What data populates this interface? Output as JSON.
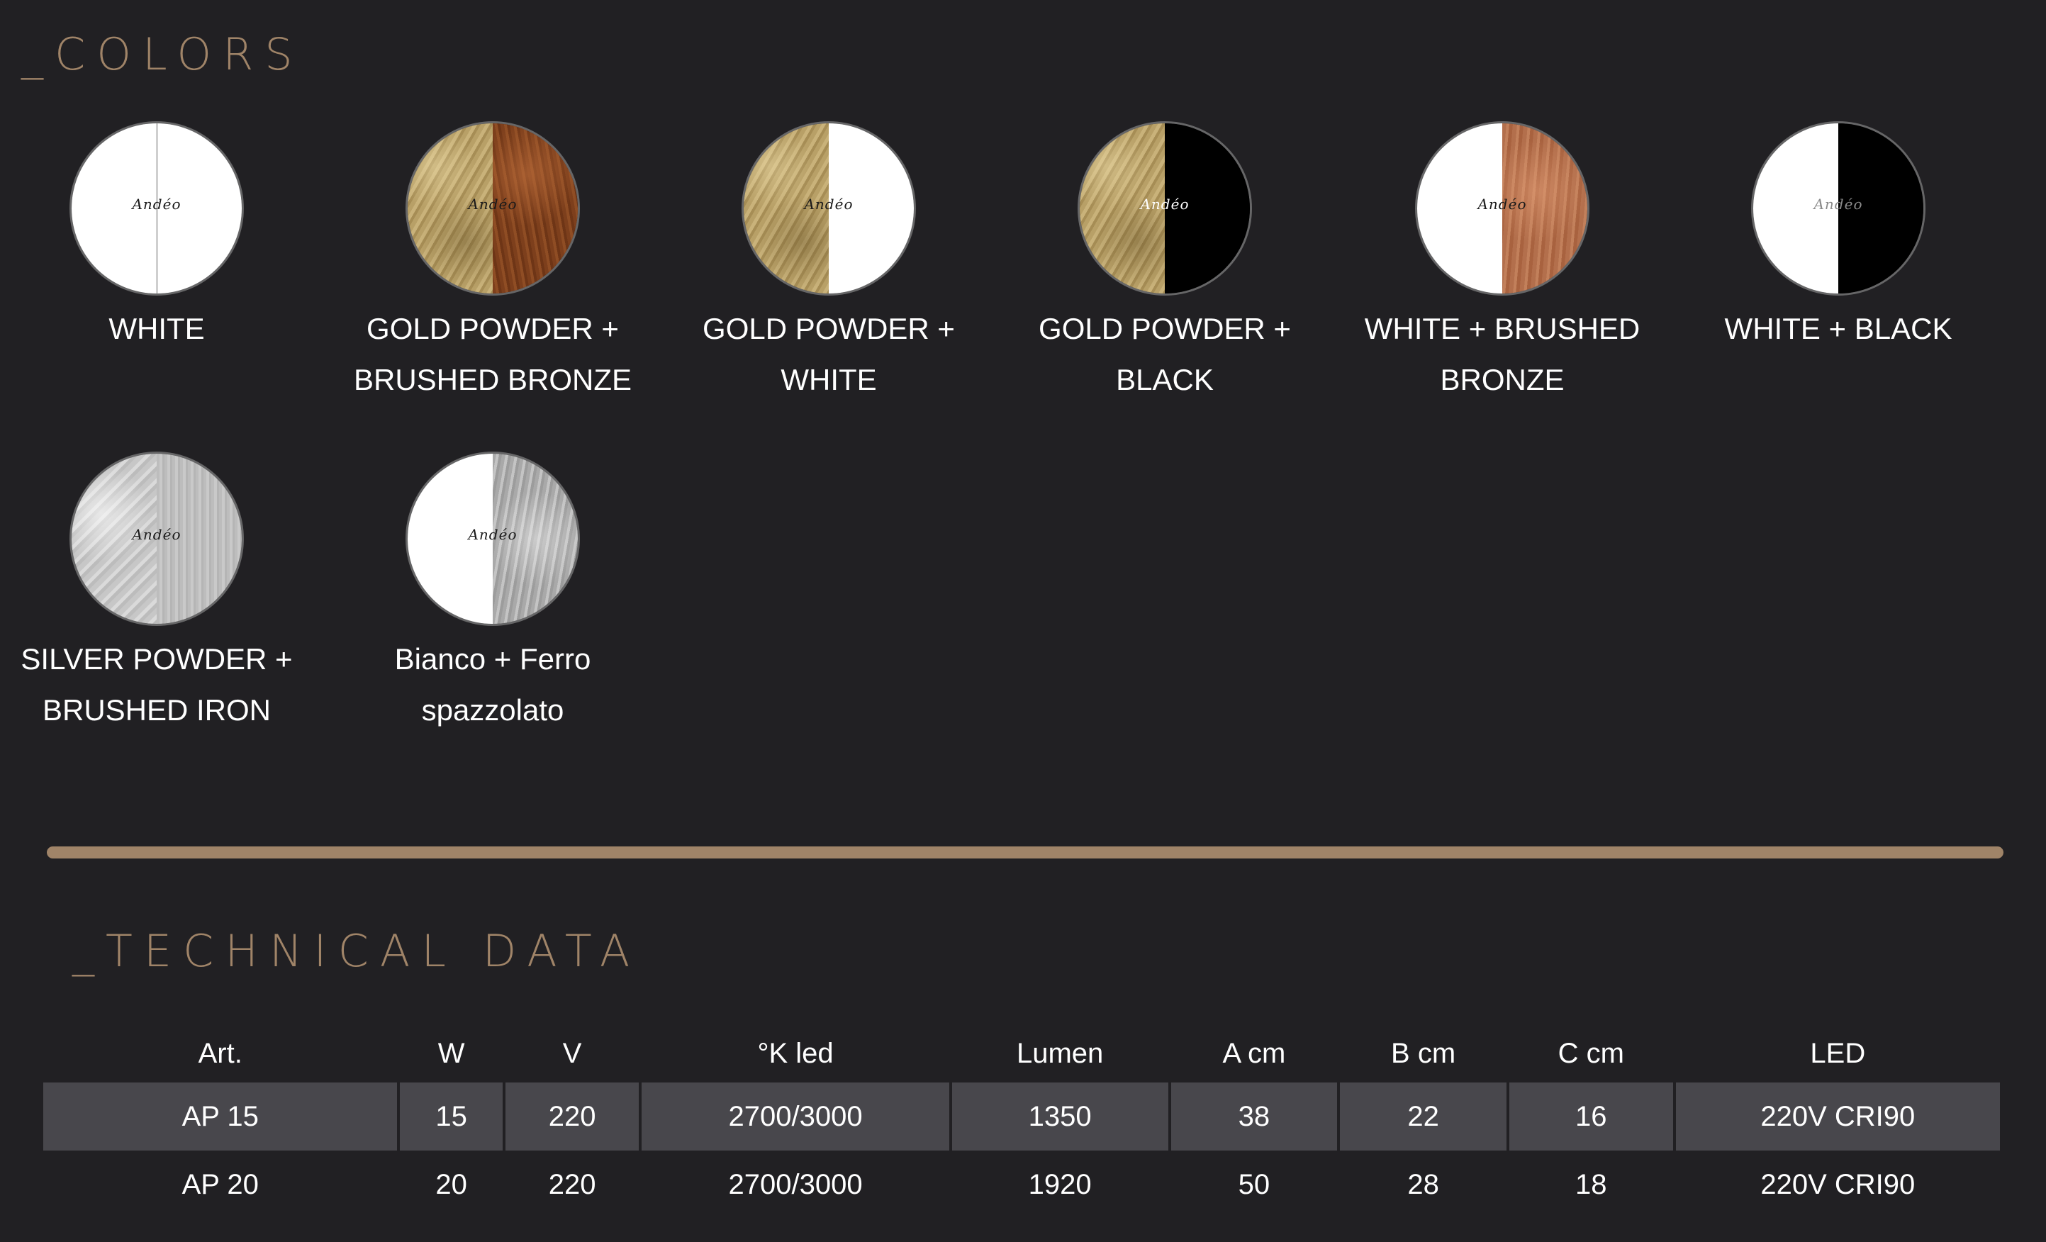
{
  "colors": {
    "title": "_COLORS",
    "logo_text": "Andéo",
    "swatches": [
      {
        "label": "WHITE"
      },
      {
        "label": "GOLD POWDER +\nBRUSHED BRONZE"
      },
      {
        "label": "GOLD POWDER +\nWHITE"
      },
      {
        "label": "GOLD POWDER +\nBLACK"
      },
      {
        "label": "WHITE + BRUSHED\nBRONZE"
      },
      {
        "label": "WHITE +  BLACK"
      },
      {
        "label": "SILVER POWDER +\nBRUSHED IRON"
      },
      {
        "label": "Bianco + Ferro\nspazzolato"
      }
    ]
  },
  "technical": {
    "title": "_TECHNICAL DATA",
    "headers": [
      "Art.",
      "W",
      "V",
      "°K led",
      "Lumen",
      "A cm",
      "B cm",
      "C cm",
      "LED"
    ],
    "rows": [
      [
        "AP 15",
        "15",
        "220",
        "2700/3000",
        "1350",
        "38",
        "22",
        "16",
        "220V CRI90"
      ],
      [
        "AP 20",
        "20",
        "220",
        "2700/3000",
        "1920",
        "50",
        "28",
        "18",
        "220V CRI90"
      ]
    ]
  },
  "theme": {
    "background": "#212023",
    "accent": "#a08468",
    "row_shade": "#48474c"
  }
}
